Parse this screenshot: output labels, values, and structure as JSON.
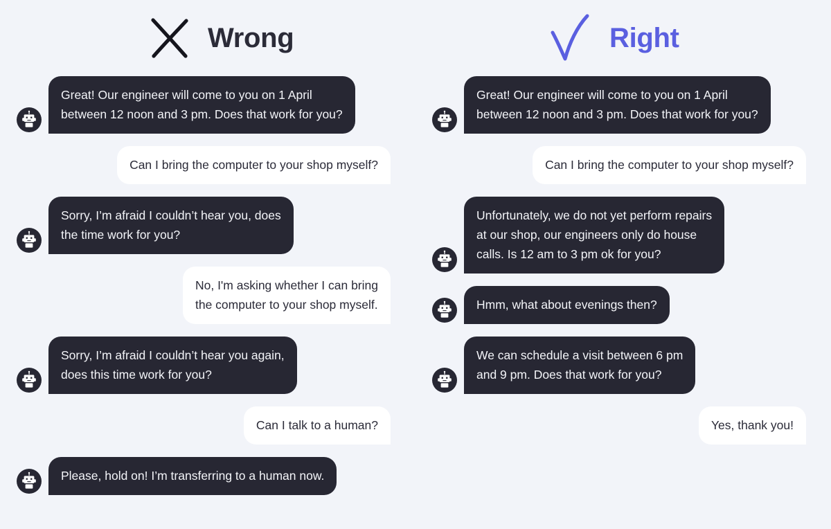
{
  "theme": {
    "background": "#f2f4f9",
    "bot_bubble": "#272733",
    "bot_text": "#f3f4f8",
    "user_bubble": "#ffffff",
    "user_text": "#2b2b38",
    "wrong_accent": "#2b2b38",
    "right_accent": "#5a5fe0"
  },
  "columns": [
    {
      "id": "wrong",
      "header": {
        "label": "Wrong",
        "icon": "cross-mark-icon"
      },
      "messages": [
        {
          "sender": "bot",
          "avatar": "robot-avatar-icon",
          "text": "Great! Our engineer will come to you on 1 April\nbetween 12 noon and 3 pm. Does that work for you?"
        },
        {
          "sender": "user",
          "text": "Can I bring the computer to your shop myself?"
        },
        {
          "sender": "bot",
          "avatar": "robot-avatar-icon",
          "text": "Sorry, I’m afraid I couldn’t hear you, does\nthe time work for you?"
        },
        {
          "sender": "user",
          "text": "No, I'm asking whether I can bring\nthe computer to your shop myself."
        },
        {
          "sender": "bot",
          "avatar": "robot-avatar-icon",
          "text": "Sorry, I’m afraid I couldn’t hear you again,\ndoes this time work for you?"
        },
        {
          "sender": "user",
          "text": "Can I talk to a human?"
        },
        {
          "sender": "bot",
          "avatar": "robot-avatar-icon",
          "text": "Please, hold on! I’m transferring to a human now."
        }
      ]
    },
    {
      "id": "right",
      "header": {
        "label": "Right",
        "icon": "check-mark-icon"
      },
      "messages": [
        {
          "sender": "bot",
          "avatar": "robot-avatar-icon",
          "text": "Great! Our engineer will come to you on 1 April\nbetween 12 noon and 3 pm. Does that work for you?"
        },
        {
          "sender": "user",
          "text": "Can I bring the computer to your shop myself?"
        },
        {
          "sender": "bot",
          "avatar": "robot-avatar-icon",
          "text": "Unfortunately, we do not yet perform repairs\nat our shop, our engineers only do house\ncalls. Is 12 am to 3 pm ok for you?"
        },
        {
          "sender": "bot",
          "avatar": "robot-avatar-icon",
          "text": "Hmm, what about evenings then?"
        },
        {
          "sender": "bot",
          "avatar": "robot-avatar-icon",
          "text": "We can schedule a visit between 6 pm\nand 9 pm. Does that work for you?"
        },
        {
          "sender": "user",
          "text": "Yes, thank you!"
        }
      ]
    }
  ]
}
